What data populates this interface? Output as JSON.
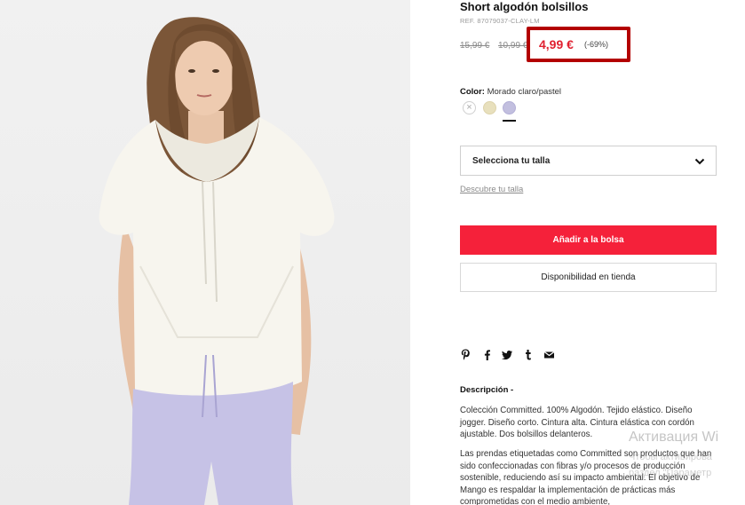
{
  "product": {
    "title": "Short algodón bolsillos",
    "ref": "REF. 87079037-CLAY-LM",
    "old_price_1": "15,99 €",
    "old_price_2": "10,99 €",
    "sale_price": "4,99 €",
    "discount": "(-69%)"
  },
  "color": {
    "label": "Color:",
    "value": "Morado claro/pastel",
    "swatches": [
      {
        "name": "unavailable",
        "hex": "#ffffff"
      },
      {
        "name": "beige",
        "hex": "#e8e0bd"
      },
      {
        "name": "lilac",
        "hex": "#c2bfdf"
      }
    ],
    "selected_index": 2
  },
  "size": {
    "select_label": "Selecciona tu talla",
    "guide_link": "Descubre tu talla"
  },
  "actions": {
    "add_to_bag": "Añadir a la bolsa",
    "store_availability": "Disponibilidad en tienda"
  },
  "share_icons": [
    "pinterest-icon",
    "facebook-icon",
    "twitter-icon",
    "tumblr-icon",
    "email-icon"
  ],
  "description": {
    "title": "Descripción -",
    "paragraph_1": "Colección Committed. 100% Algodón. Tejido elástico. Diseño jogger. Diseño corto. Cintura alta. Cintura elástica con cordón ajustable. Dos bolsillos delanteros.",
    "paragraph_2": "Las prendas etiquetadas como Committed son productos que han sido confeccionadas con fibras y/o procesos de producción sostenible, reduciendo así su impacto ambiental. El objetivo de Mango es respaldar la implementación de prácticas más comprometidas con el medio ambiente,"
  },
  "watermark": {
    "title": "Активация Wi",
    "line_1": "Чтобы активирова",
    "line_2": "раздел \"Параметр"
  },
  "colors": {
    "accent_red": "#f5213a",
    "highlight_border": "#b30000",
    "sale_price": "#e0202f"
  }
}
